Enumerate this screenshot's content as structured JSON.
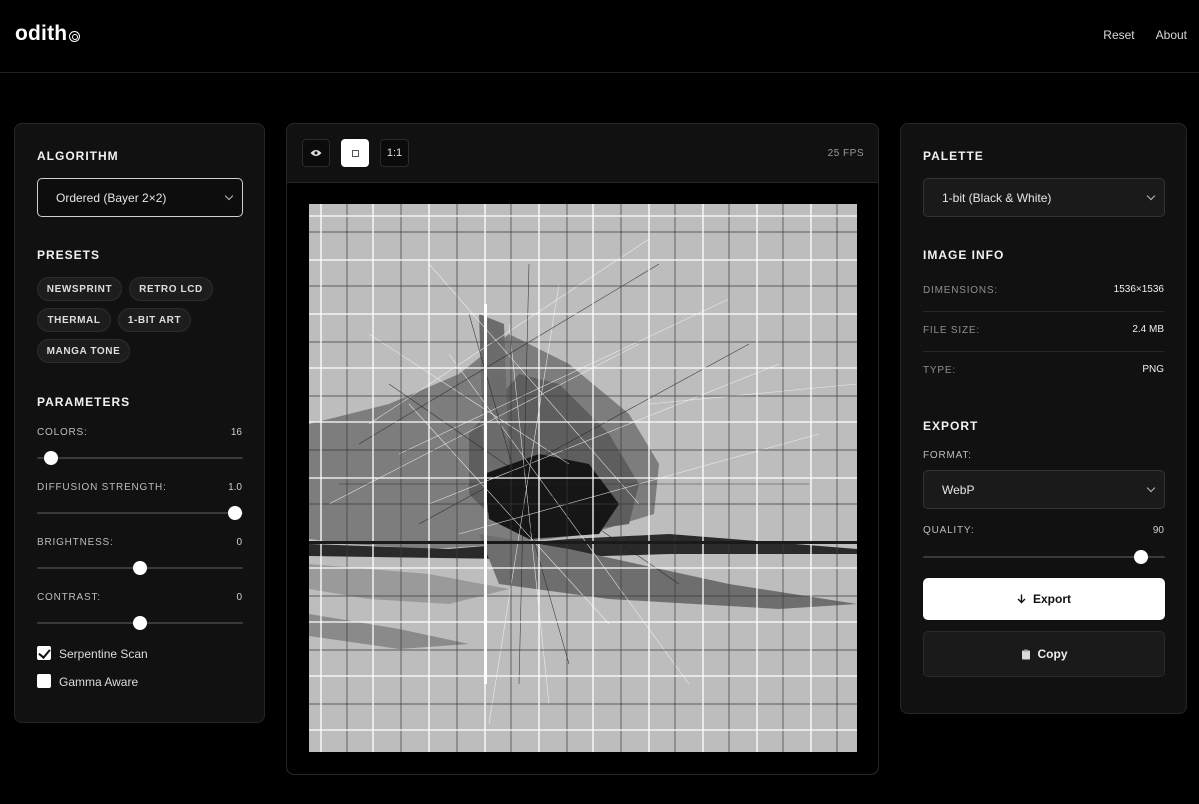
{
  "header": {
    "logo": "odith",
    "nav": [
      "Reset",
      "About"
    ]
  },
  "left": {
    "algorithm_title": "ALGORITHM",
    "algorithm_value": "Ordered (Bayer 2×2)",
    "presets_title": "PRESETS",
    "presets": [
      "NEWSPRINT",
      "RETRO LCD",
      "THERMAL",
      "1-BIT ART",
      "MANGA TONE"
    ],
    "parameters_title": "PARAMETERS",
    "params": [
      {
        "label": "COLORS:",
        "value": "16",
        "level": 0.07
      },
      {
        "label": "DIFFUSION STRENGTH:",
        "value": "1.0",
        "level": 0.96
      },
      {
        "label": "BRIGHTNESS:",
        "value": "0",
        "level": 0.5
      },
      {
        "label": "CONTRAST:",
        "value": "0",
        "level": 0.5
      }
    ],
    "checkboxes": [
      {
        "label": "Serpentine Scan",
        "checked": true
      },
      {
        "label": "Gamma Aware",
        "checked": false
      }
    ]
  },
  "center": {
    "tools": [
      "eye-icon",
      "square-icon",
      "1:1"
    ],
    "fps": "25 FPS"
  },
  "right": {
    "palette_title": "PALETTE",
    "palette_value": "1-bit (Black & White)",
    "info_title": "IMAGE INFO",
    "info": [
      {
        "key": "DIMENSIONS:",
        "value": "1536×1536"
      },
      {
        "key": "FILE SIZE:",
        "value": "2.4 MB"
      },
      {
        "key": "TYPE:",
        "value": "PNG"
      }
    ],
    "export_title": "EXPORT",
    "format_label": "FORMAT:",
    "format_value": "WebP",
    "quality_label": "QUALITY:",
    "quality_value": "90",
    "quality_level": 0.9,
    "export_button": "Export",
    "copy_button": "Copy"
  },
  "colors": {
    "background": "#000000",
    "panel": "#111111",
    "accent": "#ffffff"
  }
}
